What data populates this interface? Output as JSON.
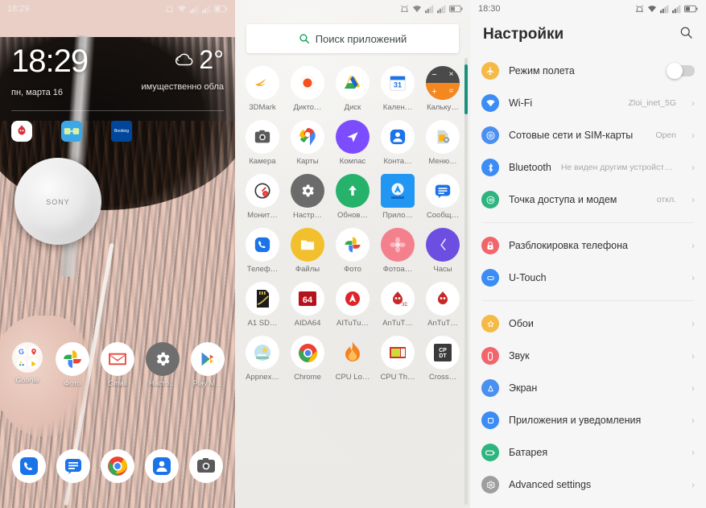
{
  "home": {
    "status": {
      "time": "18:29",
      "icons": [
        "alarm-icon",
        "wifi-icon",
        "signal-sim1-icon",
        "signal-sim2-icon",
        "battery-icon"
      ]
    },
    "clock": {
      "time": "18:29",
      "date": "пн, марта 16",
      "temperature": "2°",
      "condition": "имущественно обла",
      "weather_icon": "cloud-icon"
    },
    "shortcuts": [
      {
        "name": "antutu-shortcut",
        "label": "AnTuTu"
      },
      {
        "name": "glasses-shortcut",
        "label": "VR"
      },
      {
        "name": "booking-shortcut",
        "label": "Booking"
      }
    ],
    "apps": [
      {
        "label": "Google",
        "icon": "google-folder-icon"
      },
      {
        "label": "Фото",
        "icon": "google-photos-icon"
      },
      {
        "label": "Gmail",
        "icon": "gmail-icon"
      },
      {
        "label": "Настр…",
        "icon": "settings-gear-icon"
      },
      {
        "label": "Play М…",
        "icon": "play-music-icon"
      }
    ],
    "dock": [
      {
        "label": "Телефон",
        "icon": "phone-icon"
      },
      {
        "label": "Сообщения",
        "icon": "messages-icon"
      },
      {
        "label": "Chrome",
        "icon": "chrome-icon"
      },
      {
        "label": "Контакты",
        "icon": "contacts-icon"
      },
      {
        "label": "Камера",
        "icon": "camera-icon"
      }
    ]
  },
  "drawer": {
    "status": {
      "icons": [
        "alarm-icon",
        "wifi-icon",
        "signal-sim1-icon",
        "signal-sim2-icon",
        "battery-icon"
      ]
    },
    "search": {
      "placeholder": "Поиск приложений",
      "icon": "search-icon"
    },
    "apps": [
      {
        "label": "3DMark",
        "icon": "3dmark-icon"
      },
      {
        "label": "Дикто…",
        "icon": "recorder-icon"
      },
      {
        "label": "Диск",
        "icon": "google-drive-icon"
      },
      {
        "label": "Кален…",
        "icon": "calendar-icon",
        "day": "31"
      },
      {
        "label": "Кальку…",
        "icon": "calculator-icon"
      },
      {
        "label": "Камера",
        "icon": "camera-icon"
      },
      {
        "label": "Карты",
        "icon": "google-maps-icon"
      },
      {
        "label": "Компас",
        "icon": "compass-icon"
      },
      {
        "label": "Конта…",
        "icon": "contacts-icon"
      },
      {
        "label": "Меню…",
        "icon": "file-manager-icon"
      },
      {
        "label": "Монит…",
        "icon": "monitor-icon"
      },
      {
        "label": "Настр…",
        "icon": "settings-gear-icon"
      },
      {
        "label": "Обнов…",
        "icon": "update-icon"
      },
      {
        "label": "Прило…",
        "icon": "lenovo-app-icon"
      },
      {
        "label": "Сообщ…",
        "icon": "messages-icon"
      },
      {
        "label": "Телеф…",
        "icon": "phone-icon"
      },
      {
        "label": "Файлы",
        "icon": "files-icon"
      },
      {
        "label": "Фото",
        "icon": "google-photos-icon"
      },
      {
        "label": "Фотоа…",
        "icon": "gallery-icon"
      },
      {
        "label": "Часы",
        "icon": "clock-icon"
      },
      {
        "label": "A1 SD…",
        "icon": "sdcard-icon"
      },
      {
        "label": "AIDA64",
        "icon": "aida64-icon",
        "badge": "64"
      },
      {
        "label": "AITuTu…",
        "icon": "aitutu-icon"
      },
      {
        "label": "AnTuT…",
        "icon": "antutu-3d-icon"
      },
      {
        "label": "AnTuT…",
        "icon": "antutu-icon"
      },
      {
        "label": "Appnex…",
        "icon": "appnex-icon"
      },
      {
        "label": "Chrome",
        "icon": "chrome-icon"
      },
      {
        "label": "CPU Lo…",
        "icon": "cpu-flame-icon"
      },
      {
        "label": "CPU Th…",
        "icon": "cpu-throttle-icon"
      },
      {
        "label": "Cross…",
        "icon": "cpdt-icon",
        "badge": "CP DT"
      }
    ],
    "scrollbar": {
      "color": "#17907d"
    }
  },
  "settings": {
    "status": {
      "time": "18:30",
      "icons": [
        "alarm-icon",
        "wifi-icon",
        "signal-sim1-icon",
        "signal-sim2-icon",
        "battery-icon"
      ]
    },
    "title": "Настройки",
    "search_icon": "search-icon",
    "groups": [
      {
        "items": [
          {
            "label": "Режим полета",
            "icon": "airplane-icon",
            "color": "#f5b945",
            "control": "toggle",
            "toggle_on": false
          },
          {
            "label": "Wi-Fi",
            "icon": "wifi-icon",
            "color": "#3b8df5",
            "value": "Zloi_inet_5G",
            "control": "chevron"
          },
          {
            "label": "Сотовые сети и SIM-карты",
            "icon": "sim-icon",
            "color": "#4a90f0",
            "value": "Open",
            "control": "chevron"
          },
          {
            "label": "Bluetooth",
            "icon": "bluetooth-icon",
            "color": "#3b8df5",
            "value": "Не виден другим устройствам",
            "control": "chevron"
          },
          {
            "label": "Точка доступа и модем",
            "icon": "hotspot-icon",
            "color": "#2db47f",
            "value": "откл.",
            "control": "chevron"
          }
        ]
      },
      {
        "items": [
          {
            "label": "Разблокировка телефона",
            "icon": "lock-icon",
            "color": "#f0666b",
            "value": "",
            "control": "chevron"
          },
          {
            "label": "U-Touch",
            "icon": "utouch-icon",
            "color": "#3b8df5",
            "value": "",
            "control": "chevron"
          }
        ]
      },
      {
        "items": [
          {
            "label": "Обои",
            "icon": "wallpaper-star-icon",
            "color": "#f5b945",
            "value": "",
            "control": "chevron"
          },
          {
            "label": "Звук",
            "icon": "sound-icon",
            "color": "#f0666b",
            "value": "",
            "control": "chevron"
          },
          {
            "label": "Экран",
            "icon": "display-icon",
            "color": "#4a90f0",
            "value": "",
            "control": "chevron"
          },
          {
            "label": "Приложения и уведомления",
            "icon": "apps-icon",
            "color": "#3b8df5",
            "value": "",
            "control": "chevron"
          },
          {
            "label": "Батарея",
            "icon": "battery-icon",
            "color": "#2db47f",
            "value": "",
            "control": "chevron"
          },
          {
            "label": "Advanced settings",
            "icon": "gear-icon",
            "color": "#9e9e9e",
            "value": "",
            "control": "chevron"
          }
        ]
      }
    ]
  }
}
